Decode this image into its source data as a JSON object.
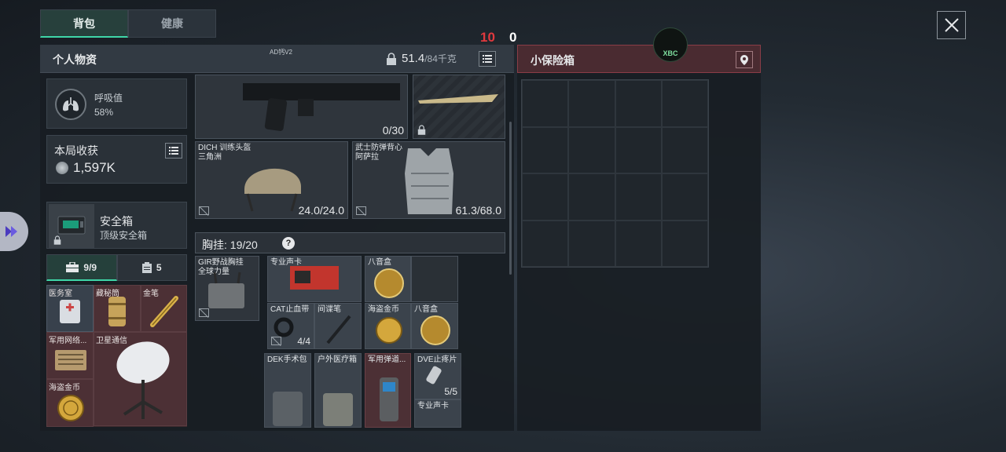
{
  "tabs": [
    {
      "label": "背包",
      "active": true
    },
    {
      "label": "健康",
      "active": false
    }
  ],
  "counters": {
    "red": "10",
    "white": "0"
  },
  "main_panel": {
    "title": "个人物资",
    "subtitle": "AD钙V2",
    "weight": "51.4",
    "weight_max": "/84千克"
  },
  "breath": {
    "label": "呼吸值",
    "value": "58%"
  },
  "harvest": {
    "label": "本局收获",
    "value": "1,597K"
  },
  "safebox": {
    "name": "安全箱",
    "desc": "顶级安全箱"
  },
  "pouch_tabs": [
    {
      "label": "9/9",
      "icon": "briefcase-icon",
      "active": true
    },
    {
      "label": "5",
      "icon": "clipboard-icon",
      "active": false
    }
  ],
  "pouch_items": [
    {
      "label": "医务室"
    },
    {
      "label": "藏秘筒"
    },
    {
      "label": "金笔"
    },
    {
      "label": "军用网络..."
    },
    {
      "label": "卫星通信"
    },
    {
      "label": "海盗金币"
    }
  ],
  "weapon": {
    "ammo": "0/30"
  },
  "helmet": {
    "name": "DICH 训练头盔",
    "sub": "三角洲",
    "durability": "24.0/24.0"
  },
  "vest": {
    "name": "武士防弹背心",
    "sub": "阿萨拉",
    "durability": "61.3/68.0"
  },
  "chest_rig": {
    "label": "胸挂:",
    "count": "19/20",
    "help": "?"
  },
  "rig_item": {
    "name": "GIR野战胸挂",
    "sub": "全球力量"
  },
  "items": {
    "pro_card": "专业声卡",
    "music_box_1": "八音盒",
    "tourniquet": "CAT止血带",
    "tourniquet_count": "4/4",
    "spy_pen": "间谍笔",
    "pirate_coin": "海盗金币",
    "music_box_2": "八音盒",
    "dek_kit": "DEK手术包",
    "outdoor_med": "户外医疗箱",
    "military_ammo": "军用弹道...",
    "dve_pills": "DVE止疼片",
    "dve_count": "5/5",
    "pro_card_2": "专业声卡"
  },
  "right_panel": {
    "title": "小保险箱",
    "logo_text": "XBC"
  },
  "colors": {
    "accent": "#3fd6a8",
    "alert_red": "#e0393e",
    "rare_red": "#4c3035"
  }
}
